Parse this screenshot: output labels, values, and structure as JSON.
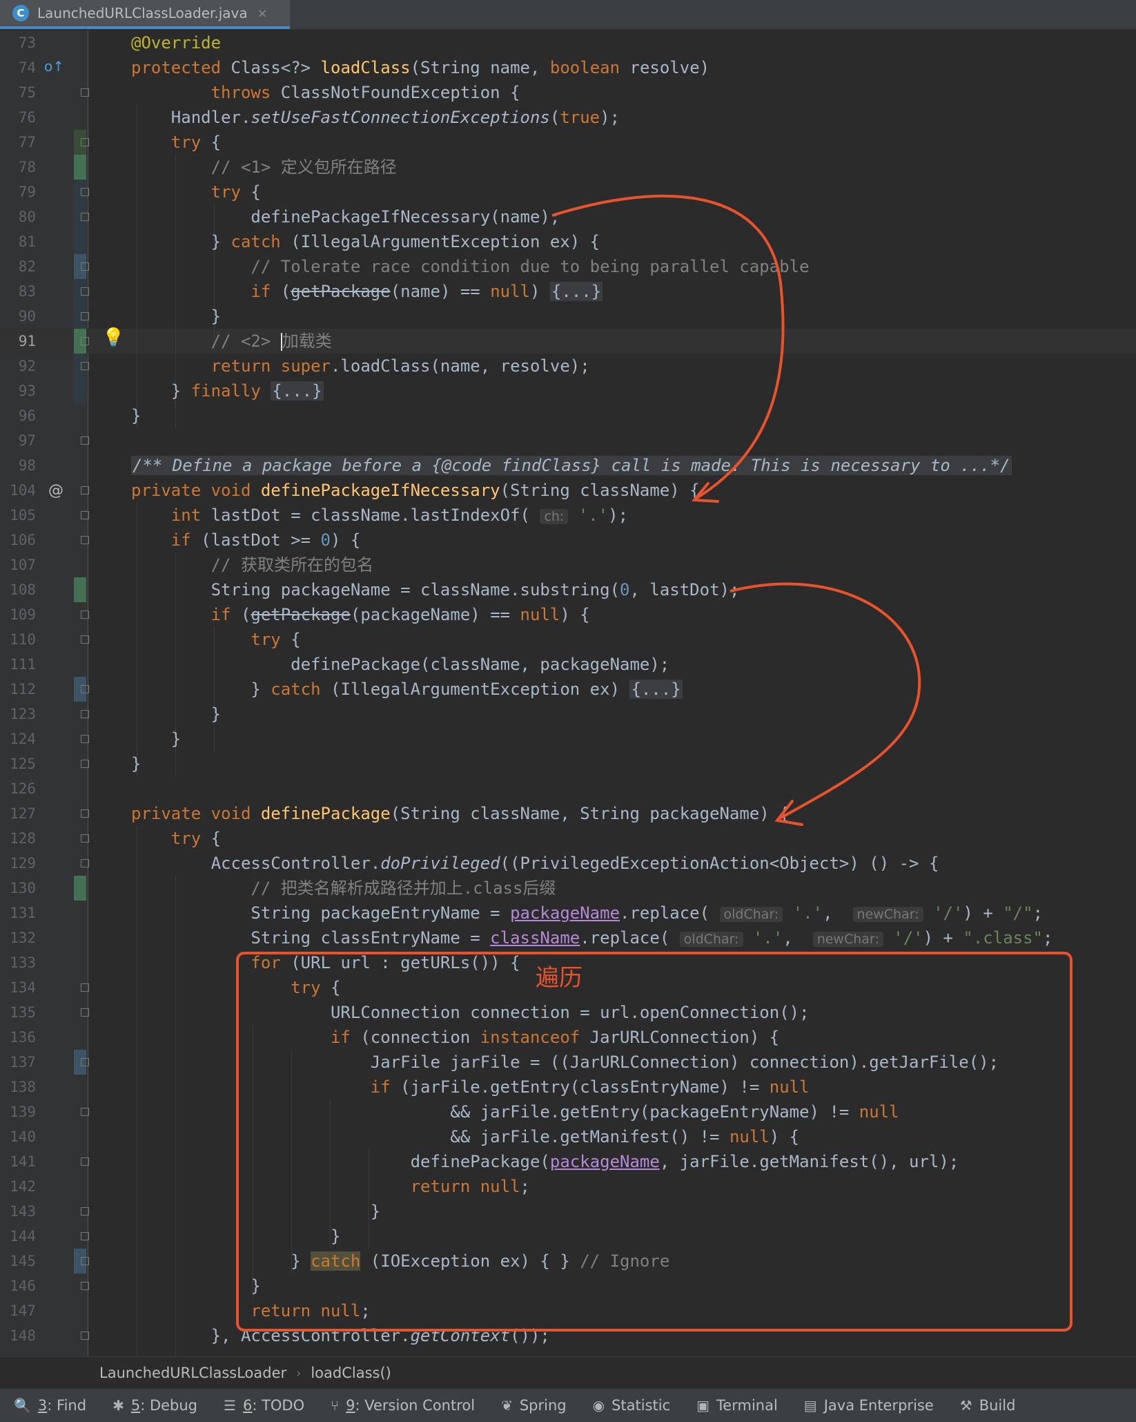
{
  "tab": {
    "icon_letter": "C",
    "label": "LaunchedURLClassLoader.java",
    "close": "×"
  },
  "lines": [
    {
      "n": "73",
      "h": "<span class=\"an\">@Override</span>"
    },
    {
      "n": "74",
      "h": "<span class=\"kw\">protected</span> Class&lt;?&gt; <span class=\"fn\">loadClass</span>(String name, <span class=\"kw\">boolean</span> resolve)"
    },
    {
      "n": "75",
      "h": "        <span class=\"kw\">throws</span> ClassNotFoundException {"
    },
    {
      "n": "76",
      "h": "    Handler.<span class=\"it\">setUseFastConnectionExceptions</span>(<span class=\"kw\">true</span>);"
    },
    {
      "n": "77",
      "h": "    <span class=\"kw\">try</span> {"
    },
    {
      "n": "78",
      "h": "        <span class=\"cm\">// &lt;1&gt; 定义包所在路径</span>"
    },
    {
      "n": "79",
      "h": "        <span class=\"kw\">try</span> {"
    },
    {
      "n": "80",
      "h": "            definePackageIfNecessary(name);"
    },
    {
      "n": "81",
      "h": "        } <span class=\"kw\">catch</span> (IllegalArgumentException ex) {"
    },
    {
      "n": "82",
      "h": "            <span class=\"cm\">// Tolerate race condition due to being parallel capable</span>"
    },
    {
      "n": "83",
      "h": "            <span class=\"kw\">if</span> (<span class=\"str-through\">getPackage</span>(name) == <span class=\"kw\">null</span>) <span class=\"fold-txt\">{...}</span>"
    },
    {
      "n": "90",
      "h": "        }"
    },
    {
      "n": "91",
      "h": "        <span class=\"cm\">// &lt;2&gt; <span class=\"caret\"></span>加载类</span>",
      "cur": true
    },
    {
      "n": "92",
      "h": "        <span class=\"kw\">return super</span>.loadClass(name, resolve);"
    },
    {
      "n": "93",
      "h": "    } <span class=\"kw\">finally</span> <span class=\"fold-txt\">{...}</span>"
    },
    {
      "n": "96",
      "h": "}"
    },
    {
      "n": "97",
      "h": ""
    },
    {
      "n": "98",
      "h": "<span class=\"cm it fold-txt\">/** Define a package before a {@code findClass} call is made. This is necessary to ...*/</span>"
    },
    {
      "n": "104",
      "h": "<span class=\"kw\">private void</span> <span class=\"fn\">definePackageIfNecessary</span>(String className) {"
    },
    {
      "n": "105",
      "h": "    <span class=\"kw\">int</span> lastDot = className.lastIndexOf( <span class=\"hint\">ch:</span> <span class=\"str\">'.'</span>);"
    },
    {
      "n": "106",
      "h": "    <span class=\"kw\">if</span> (lastDot &gt;= <span class=\"num\">0</span>) {"
    },
    {
      "n": "107",
      "h": "        <span class=\"cm\">// 获取类所在的包名</span>"
    },
    {
      "n": "108",
      "h": "        String packageName = className.substring(<span class=\"num\">0</span>, lastDot);"
    },
    {
      "n": "109",
      "h": "        <span class=\"kw\">if</span> (<span class=\"str-through\">getPackage</span>(packageName) == <span class=\"kw\">null</span>) {"
    },
    {
      "n": "110",
      "h": "            <span class=\"kw\">try</span> {"
    },
    {
      "n": "111",
      "h": "                definePackage(className, packageName);"
    },
    {
      "n": "112",
      "h": "            } <span class=\"kw\">catch</span> (IllegalArgumentException ex) <span class=\"fold-txt\">{...}</span>"
    },
    {
      "n": "123",
      "h": "        }"
    },
    {
      "n": "124",
      "h": "    }"
    },
    {
      "n": "125",
      "h": "}"
    },
    {
      "n": "126",
      "h": ""
    },
    {
      "n": "127",
      "h": "<span class=\"kw\">private void</span> <span class=\"fn\">definePackage</span>(String className, String packageName) {"
    },
    {
      "n": "128",
      "h": "    <span class=\"kw\">try</span> {"
    },
    {
      "n": "129",
      "h": "        AccessController.<span class=\"it\">doPrivileged</span>((PrivilegedExceptionAction&lt;Object&gt;) () -&gt; {"
    },
    {
      "n": "130",
      "h": "            <span class=\"cm\">// 把类名解析成路径并加上.class后缀</span>"
    },
    {
      "n": "131",
      "h": "            String packageEntryName = <span class=\"pv\">packageName</span>.replace( <span class=\"hint\">oldChar:</span> <span class=\"str\">'.'</span>,  <span class=\"hint\">newChar:</span> <span class=\"str\">'/'</span>) + <span class=\"str\">\"/\"</span>;"
    },
    {
      "n": "132",
      "h": "            String classEntryName = <span class=\"pv\">className</span>.replace( <span class=\"hint\">oldChar:</span> <span class=\"str\">'.'</span>,  <span class=\"hint\">newChar:</span> <span class=\"str\">'/'</span>) + <span class=\"str\">\".class\"</span>;"
    },
    {
      "n": "133",
      "h": "            <span class=\"kw\">for</span> (URL url : getURLs()) {"
    },
    {
      "n": "134",
      "h": "                <span class=\"kw\">try</span> {"
    },
    {
      "n": "135",
      "h": "                    URLConnection connection = url.openConnection();"
    },
    {
      "n": "136",
      "h": "                    <span class=\"kw\">if</span> (connection <span class=\"kw\">instanceof</span> JarURLConnection) {"
    },
    {
      "n": "137",
      "h": "                        JarFile jarFile = ((JarURLConnection) connection).getJarFile();"
    },
    {
      "n": "138",
      "h": "                        <span class=\"kw\">if</span> (jarFile.getEntry(classEntryName) != <span class=\"kw\">null</span>"
    },
    {
      "n": "139",
      "h": "                                &amp;&amp; jarFile.getEntry(packageEntryName) != <span class=\"kw\">null</span>"
    },
    {
      "n": "140",
      "h": "                                &amp;&amp; jarFile.getManifest() != <span class=\"kw\">null</span>) {"
    },
    {
      "n": "141",
      "h": "                            definePackage(<span class=\"pv\">packageName</span>, jarFile.getManifest(), url);"
    },
    {
      "n": "142",
      "h": "                            <span class=\"kw\">return null</span>;"
    },
    {
      "n": "143",
      "h": "                        }"
    },
    {
      "n": "144",
      "h": "                    }"
    },
    {
      "n": "145",
      "h": "                } <span class=\"kw hl\">catch</span> (IOException ex) { } <span class=\"cm\">// Ignore</span>"
    },
    {
      "n": "146",
      "h": "            }"
    },
    {
      "n": "147",
      "h": "            <span class=\"kw\">return null</span>;"
    },
    {
      "n": "148",
      "h": "        }, AccessController.<span class=\"it\">getContext</span>());"
    }
  ],
  "annotation": {
    "note": "遍历",
    "color": "#e8532c"
  },
  "breadcrumb": {
    "class_name": "LaunchedURLClassLoader",
    "method": "loadClass()"
  },
  "toolbar": [
    {
      "icon": "🔍",
      "key": "3",
      "label": ": Find",
      "name": "tool-find"
    },
    {
      "icon": "✱",
      "key": "5",
      "label": ": Debug",
      "name": "tool-debug"
    },
    {
      "icon": "☰",
      "key": "6",
      "label": ": TODO",
      "name": "tool-todo"
    },
    {
      "icon": "⑂",
      "key": "9",
      "label": ": Version Control",
      "name": "tool-version-control"
    },
    {
      "icon": "❦",
      "key": "",
      "label": "Spring",
      "name": "tool-spring"
    },
    {
      "icon": "◉",
      "key": "",
      "label": "Statistic",
      "name": "tool-statistic"
    },
    {
      "icon": "▣",
      "key": "",
      "label": "Terminal",
      "name": "tool-terminal"
    },
    {
      "icon": "▤",
      "key": "",
      "label": "Java Enterprise",
      "name": "tool-java-enterprise"
    },
    {
      "icon": "⚒",
      "key": "",
      "label": "Build",
      "name": "tool-build"
    }
  ]
}
